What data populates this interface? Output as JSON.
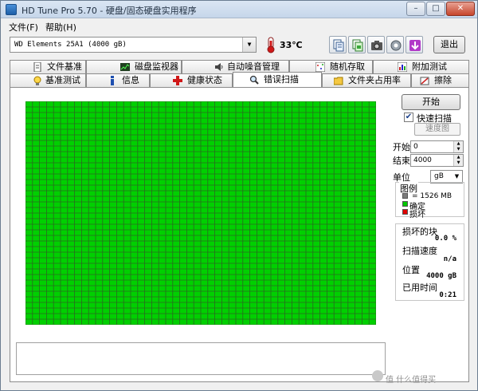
{
  "window": {
    "title": "HD Tune Pro 5.70 - 硬盘/固态硬盘实用程序"
  },
  "menu": [
    {
      "label": "文件(F)"
    },
    {
      "label": "帮助(H)"
    }
  ],
  "toolbar": {
    "drive_label": "WD    Elements 25A1 (4000 gB)",
    "temperature": "33℃",
    "exit_label": "退出",
    "buttons": [
      "copy-text-icon",
      "copy-screenshot-icon",
      "camera-icon",
      "settings-icon",
      "download-icon"
    ]
  },
  "tabs": {
    "row1": [
      {
        "label": "文件基准",
        "icon": "file-benchmark-icon"
      },
      {
        "label": "磁盘监视器",
        "icon": "disk-monitor-icon"
      },
      {
        "label": "自动噪音管理",
        "icon": "speaker-icon"
      },
      {
        "label": "随机存取",
        "icon": "random-access-icon"
      },
      {
        "label": "附加测试",
        "icon": "extra-tests-icon"
      }
    ],
    "row2": [
      {
        "label": "基准测试",
        "icon": "benchmark-icon"
      },
      {
        "label": "信息",
        "icon": "info-icon"
      },
      {
        "label": "健康状态",
        "icon": "health-icon"
      },
      {
        "label": "错误扫描",
        "icon": "magnifier-icon",
        "active": true
      },
      {
        "label": "文件夹占用率",
        "icon": "folder-icon"
      },
      {
        "label": "擦除",
        "icon": "erase-icon"
      }
    ]
  },
  "error_scan": {
    "block_map": {
      "columns": 50,
      "rows": 40,
      "good_color": "#00d000",
      "grid_color": "#2a6a20",
      "damaged_blocks": 0
    },
    "start_label": "开始",
    "quick_scan_label": "快速扫描",
    "quick_scan_checked": true,
    "speed_map_label": "速度图",
    "start_field_label": "开始",
    "start_value": "0",
    "end_field_label": "结束",
    "end_value": "4000",
    "unit_label": "单位",
    "unit_value": "gB",
    "legend": {
      "title": "图例",
      "block_size": "= 1526 MB",
      "ok_label": "确定",
      "damaged_label": "损坏",
      "ok_color": "#00c800",
      "damaged_color": "#e00000"
    },
    "stats": {
      "damaged_blocks_label": "损坏的块",
      "damaged_blocks_value": "0.0 %",
      "scan_speed_label": "扫描速度",
      "scan_speed_value": "n/a",
      "position_label": "位置",
      "position_value": "4000 gB",
      "elapsed_label": "已用时间",
      "elapsed_value": "0:21"
    }
  },
  "watermark": "值 什么值得买"
}
